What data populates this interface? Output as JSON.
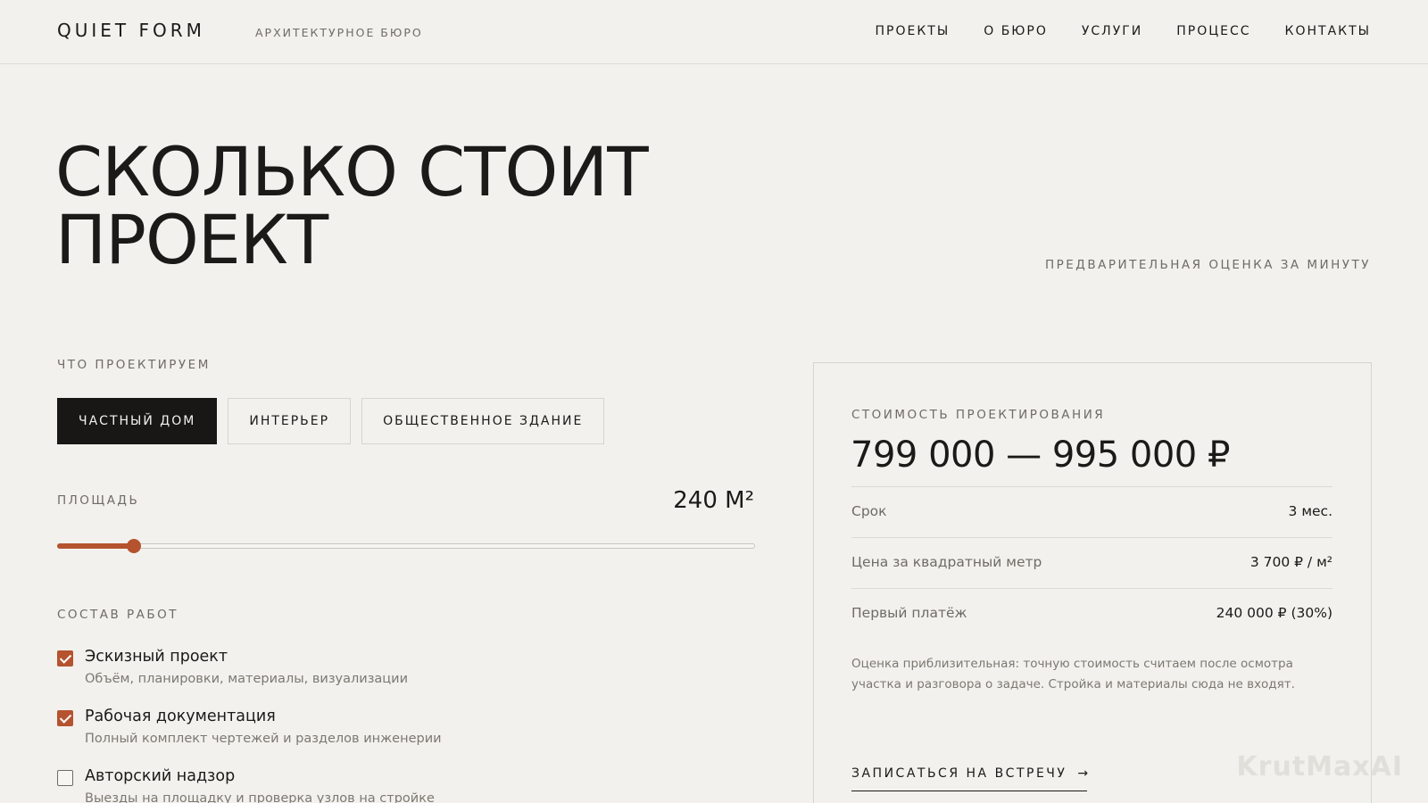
{
  "header": {
    "logo": "QUIET FORM",
    "tagline": "АРХИТЕКТУРНОЕ БЮРО",
    "nav": [
      "ПРОЕКТЫ",
      "О БЮРО",
      "УСЛУГИ",
      "ПРОЦЕСС",
      "КОНТАКТЫ"
    ]
  },
  "hero": {
    "title_line1": "СКОЛЬКО СТОИТ",
    "title_line2": "ПРОЕКТ",
    "subtitle": "ПРЕДВАРИТЕЛЬНАЯ ОЦЕНКА ЗА МИНУТУ"
  },
  "calculator": {
    "type_label": "ЧТО ПРОЕКТИРУЕМ",
    "types": [
      {
        "label": "ЧАСТНЫЙ ДОМ",
        "active": true
      },
      {
        "label": "ИНТЕРЬЕР",
        "active": false
      },
      {
        "label": "ОБЩЕСТВЕННОЕ ЗДАНИЕ",
        "active": false
      }
    ],
    "area_label": "ПЛОЩАДЬ",
    "area_value": "240 М²",
    "area_slider_fraction": 0.11,
    "works_label": "СОСТАВ РАБОТ",
    "works": [
      {
        "title": "Эскизный проект",
        "desc": "Объём, планировки, материалы, визуализации",
        "checked": true
      },
      {
        "title": "Рабочая документация",
        "desc": "Полный комплект чертежей и разделов инженерии",
        "checked": true
      },
      {
        "title": "Авторский надзор",
        "desc": "Выезды на площадку и проверка узлов на стройке",
        "checked": false
      }
    ]
  },
  "result": {
    "label": "СТОИМОСТЬ ПРОЕКТИРОВАНИЯ",
    "price": "799 000 — 995 000 ₽",
    "rows": [
      {
        "label": "Срок",
        "value": "3 мес."
      },
      {
        "label": "Цена за квадратный метр",
        "value": "3 700 ₽ / м²"
      },
      {
        "label": "Первый платёж",
        "value": "240 000 ₽ (30%)"
      }
    ],
    "note": "Оценка приблизительная: точную стоимость считаем после осмотра участка и разговора о задаче. Стройка и материалы сюда не входят.",
    "cta": "ЗАПИСАТЬСЯ НА ВСТРЕЧУ",
    "cta_icon": "arrow-right-icon"
  },
  "watermark": "KrutMaxAI",
  "colors": {
    "background": "#f2f1ed",
    "text": "#1b1a18",
    "accent": "#b5532e",
    "active_tab": "#181716"
  }
}
